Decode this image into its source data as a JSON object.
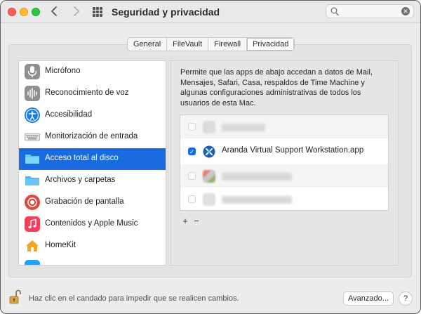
{
  "window": {
    "title": "Seguridad y privacidad",
    "search": {
      "value": "",
      "placeholder": ""
    }
  },
  "tabs": [
    {
      "label": "General",
      "active": false
    },
    {
      "label": "FileVault",
      "active": false
    },
    {
      "label": "Firewall",
      "active": false
    },
    {
      "label": "Privacidad",
      "active": true
    }
  ],
  "sidebar": {
    "items": [
      {
        "label": "Micrófono",
        "icon": "microphone-icon",
        "color": "#8e8e93",
        "selected": false
      },
      {
        "label": "Reconocimiento de voz",
        "icon": "voice-waveform-icon",
        "color": "#8e8e93",
        "selected": false
      },
      {
        "label": "Accesibilidad",
        "icon": "accessibility-icon",
        "color": "#1a7bea",
        "selected": false
      },
      {
        "label": "Monitorización de entrada",
        "icon": "keyboard-icon",
        "color": "#cfcfcf",
        "selected": false
      },
      {
        "label": "Acceso total al disco",
        "icon": "folder-icon",
        "color": "#5ac8fa",
        "selected": true
      },
      {
        "label": "Archivos y carpetas",
        "icon": "folder-icon",
        "color": "#5ac8fa",
        "selected": false
      },
      {
        "label": "Grabación de pantalla",
        "icon": "screen-record-icon",
        "color": "#e5453a",
        "selected": false
      },
      {
        "label": "Contenidos y Apple Music",
        "icon": "music-note-icon",
        "color": "#fc3c58",
        "selected": false
      },
      {
        "label": "HomeKit",
        "icon": "home-icon",
        "color": "#f5a623",
        "selected": false
      },
      {
        "label": "",
        "icon": "partial-icon",
        "color": "#2a9df4",
        "selected": false
      }
    ]
  },
  "description": "Permite que las apps de abajo accedan a datos de Mail, Mensajes, Safari, Casa, respaldos de Time Machine y algunas configuraciones administrativas de todos los usuarios de esta Mac.",
  "apps": [
    {
      "name": "",
      "checked": false,
      "blurred": true,
      "alt": true
    },
    {
      "name": "Aranda Virtual Support Workstation.app",
      "checked": true,
      "blurred": false,
      "alt": false
    },
    {
      "name": "",
      "checked": false,
      "blurred": true,
      "alt": true
    },
    {
      "name": "",
      "checked": false,
      "blurred": true,
      "alt": false
    }
  ],
  "list_controls": {
    "add": "+",
    "remove": "−"
  },
  "footer": {
    "lock_hint": "Haz clic en el candado para impedir que se realicen cambios.",
    "advanced_label": "Avanzado...",
    "help_label": "?"
  },
  "colors": {
    "accent": "#1a6be0"
  }
}
